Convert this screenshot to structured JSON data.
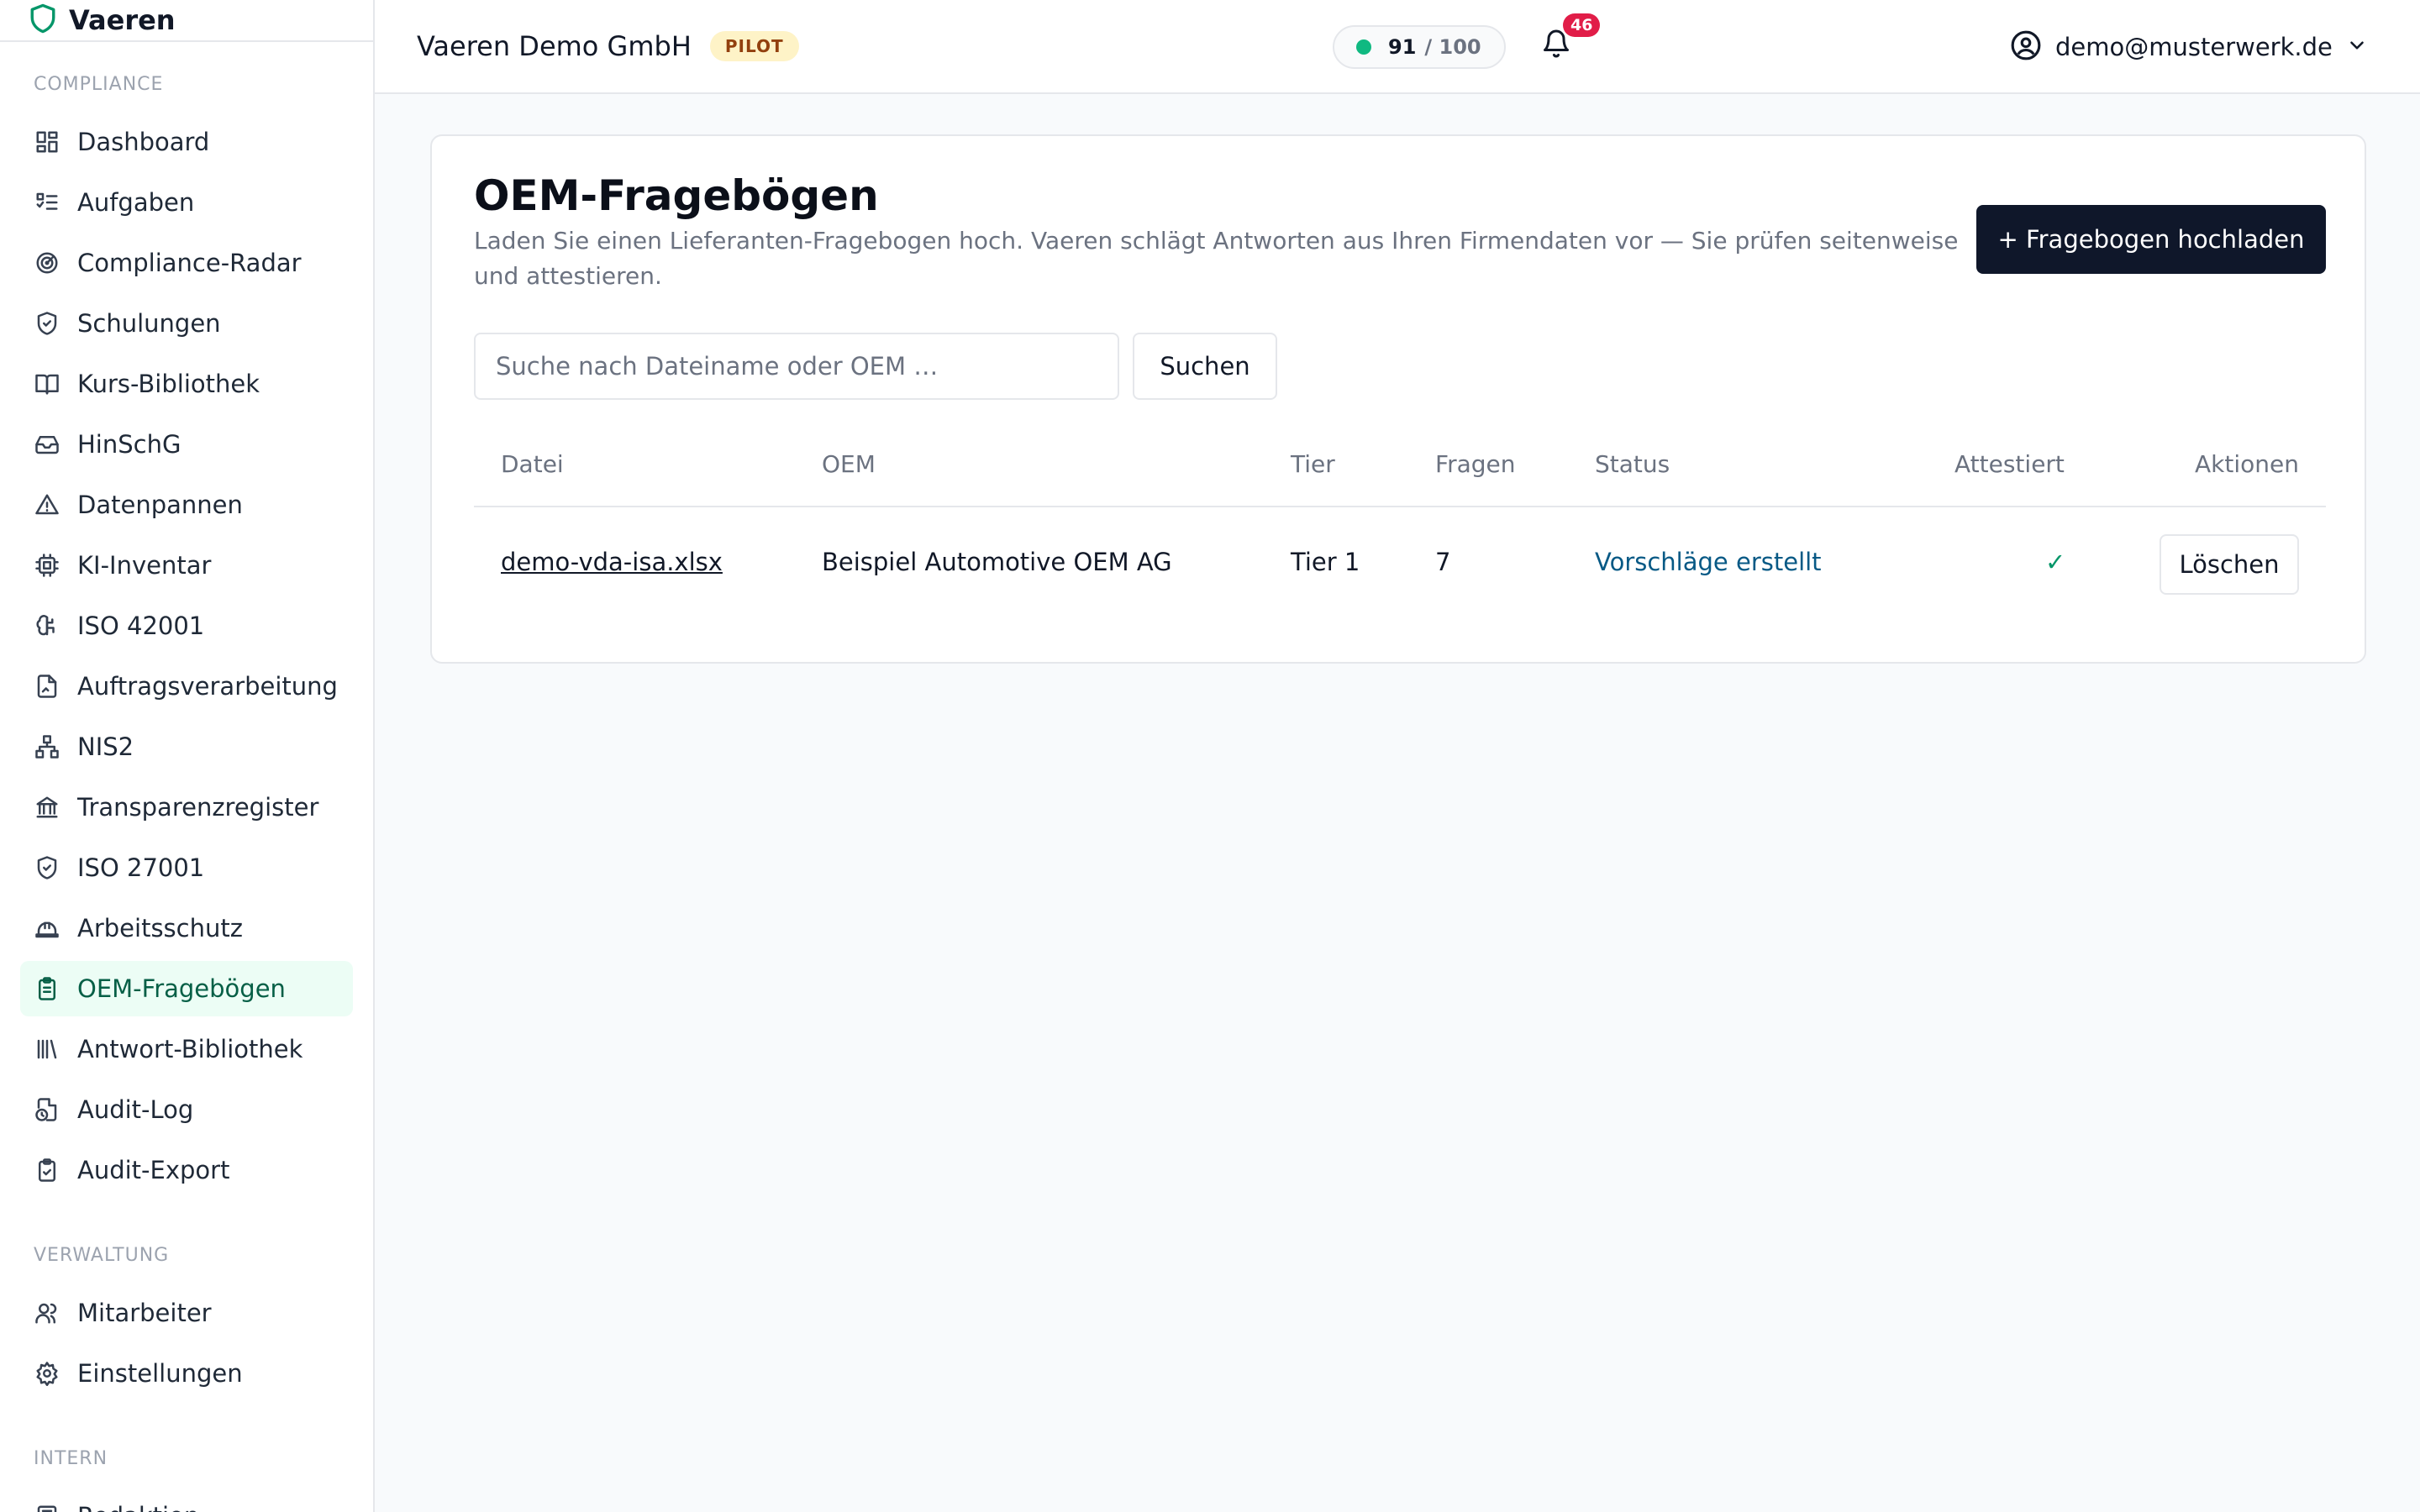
{
  "app": {
    "brand": "Vaeren"
  },
  "sidebar": {
    "sections": [
      {
        "label": "COMPLIANCE",
        "items": [
          {
            "label": "Dashboard",
            "icon": "dashboard-icon"
          },
          {
            "label": "Aufgaben",
            "icon": "tasks-icon"
          },
          {
            "label": "Compliance-Radar",
            "icon": "radar-icon"
          },
          {
            "label": "Schulungen",
            "icon": "shield-check-icon"
          },
          {
            "label": "Kurs-Bibliothek",
            "icon": "book-icon"
          },
          {
            "label": "HinSchG",
            "icon": "inbox-icon"
          },
          {
            "label": "Datenpannen",
            "icon": "warning-icon"
          },
          {
            "label": "KI-Inventar",
            "icon": "cpu-icon"
          },
          {
            "label": "ISO 42001",
            "icon": "brain-icon"
          },
          {
            "label": "Auftragsverarbeitung",
            "icon": "file-sign-icon"
          },
          {
            "label": "NIS2",
            "icon": "network-icon"
          },
          {
            "label": "Transparenzregister",
            "icon": "bank-icon"
          },
          {
            "label": "ISO 27001",
            "icon": "shield-check-icon"
          },
          {
            "label": "Arbeitsschutz",
            "icon": "hard-hat-icon"
          },
          {
            "label": "OEM-Fragebögen",
            "icon": "clipboard-icon",
            "active": true
          },
          {
            "label": "Antwort-Bibliothek",
            "icon": "library-icon"
          },
          {
            "label": "Audit-Log",
            "icon": "file-clock-icon"
          },
          {
            "label": "Audit-Export",
            "icon": "clipboard-check-icon"
          }
        ]
      },
      {
        "label": "VERWALTUNG",
        "items": [
          {
            "label": "Mitarbeiter",
            "icon": "users-icon"
          },
          {
            "label": "Einstellungen",
            "icon": "gear-icon"
          }
        ]
      },
      {
        "label": "INTERN",
        "items": [
          {
            "label": "Redaktion",
            "icon": "newspaper-icon"
          }
        ]
      }
    ]
  },
  "header": {
    "org_name": "Vaeren Demo GmbH",
    "badge": "PILOT",
    "score_value": "91",
    "score_max": "/ 100",
    "score_color": "#10b981",
    "notification_count": "46",
    "user_email": "demo@musterwerk.de"
  },
  "main": {
    "title": "OEM-Fragebögen",
    "subtitle": "Laden Sie einen Lieferanten-Fragebogen hoch. Vaeren schlägt Antworten aus Ihren Firmendaten vor — Sie prüfen seitenweise und attestieren.",
    "upload_button": "+ Fragebogen hochladen",
    "search_placeholder": "Suche nach Dateiname oder OEM …",
    "search_value": "",
    "search_button": "Suchen",
    "table": {
      "columns": [
        "Datei",
        "OEM",
        "Tier",
        "Fragen",
        "Status",
        "Attestiert",
        "Aktionen"
      ],
      "rows": [
        {
          "file": "demo-vda-isa.xlsx",
          "oem": "Beispiel Automotive OEM AG",
          "tier": "Tier 1",
          "questions": "7",
          "status": "Vorschläge erstellt",
          "attested": "✓",
          "action": "Löschen"
        }
      ]
    }
  }
}
